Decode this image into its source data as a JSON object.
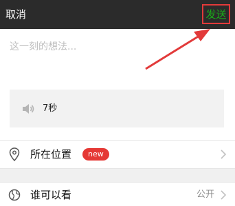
{
  "topbar": {
    "cancel_label": "取消",
    "send_label": "发送"
  },
  "composer": {
    "placeholder": "这一刻的想法..."
  },
  "voice": {
    "icon": "speaker-icon",
    "duration": "7秒"
  },
  "rows": {
    "location": {
      "icon": "location-pin-icon",
      "label": "所在位置",
      "badge": "new"
    },
    "visibility": {
      "icon": "globe-icon",
      "label": "谁可以看",
      "value": "公开"
    }
  },
  "colors": {
    "topbar_bg": "#2b2b2b",
    "send_green": "#1aad19",
    "annotation_red": "#e23a3a",
    "badge_red": "#e53935"
  }
}
